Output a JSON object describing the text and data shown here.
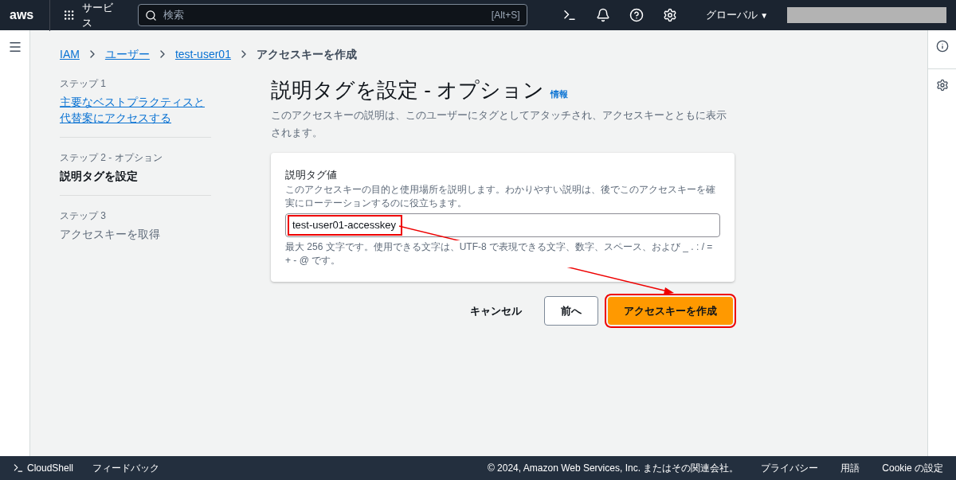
{
  "top_bar": {
    "logo": "aws",
    "services": "サービス",
    "search": {
      "placeholder": "検索",
      "shortcut": "[Alt+S]"
    },
    "region": "グローバル",
    "region_caret": "▼"
  },
  "breadcrumb": [
    {
      "label": "IAM",
      "link": true
    },
    {
      "label": "ユーザー",
      "link": true
    },
    {
      "label": "test-user01",
      "link": true
    },
    {
      "label": "アクセスキーを作成",
      "link": false
    }
  ],
  "steps": [
    {
      "step": "ステップ 1",
      "label": "主要なベストプラクティスと代替案にアクセスする",
      "selected": false,
      "link": true
    },
    {
      "step": "ステップ 2 - オプション",
      "label": "説明タグを設定",
      "selected": true,
      "link": false
    },
    {
      "step": "ステップ 3",
      "label": "アクセスキーを取得",
      "selected": false,
      "link": false
    }
  ],
  "heading": {
    "title": "説明タグを設定 - オプション",
    "info": "情報",
    "description": "このアクセスキーの説明は、このユーザーにタグとしてアタッチされ、アクセスキーとともに表示されます。"
  },
  "form": {
    "label": "説明タグ値",
    "hint": "このアクセスキーの目的と使用場所を説明します。わかりやすい説明は、後でこのアクセスキーを確実にローテーションするのに役立ちます。",
    "value": "test-user01-accesskey",
    "constraint": "最大 256 文字です。使用できる文字は、UTF-8 で表現できる文字、数字、スペース、および _ . : / = + - @ です。"
  },
  "buttons": [
    {
      "label": "キャンセル",
      "kind": "link"
    },
    {
      "label": "前へ",
      "kind": "normal"
    },
    {
      "label": "アクセスキーを作成",
      "kind": "primary"
    }
  ],
  "footer": {
    "cloudshell": "CloudShell",
    "feedback": "フィードバック",
    "copyright": "© 2024, Amazon Web Services, Inc. またはその関連会社。",
    "links": [
      "プライバシー",
      "用語",
      "Cookie の設定"
    ]
  }
}
